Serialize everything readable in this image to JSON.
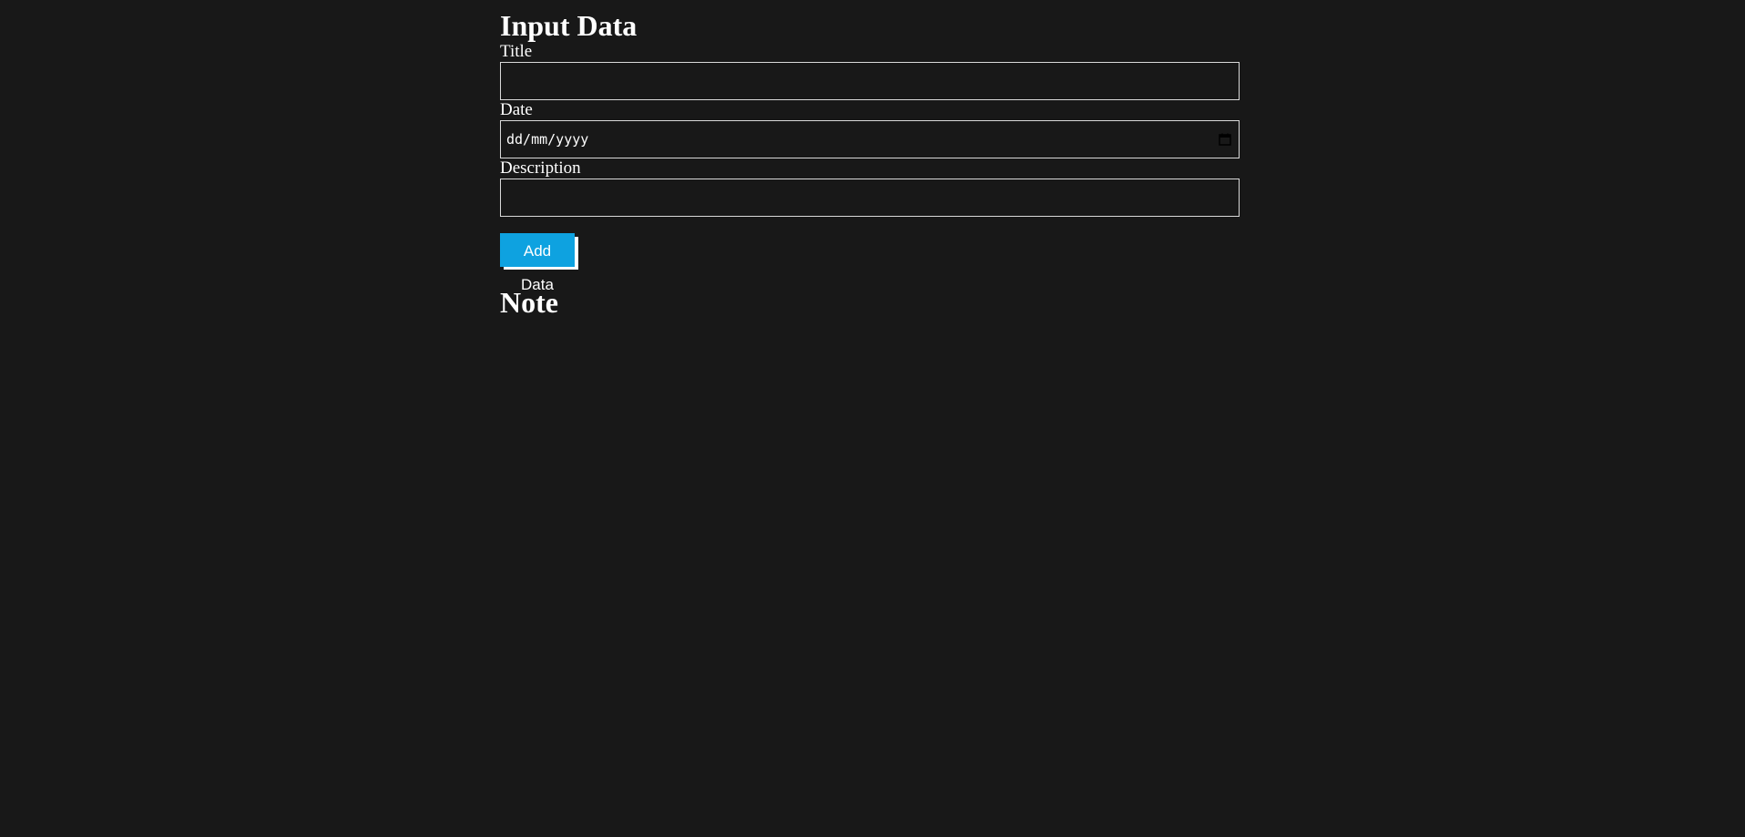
{
  "form": {
    "heading": "Input Data",
    "title_label": "Title",
    "title_value": "",
    "date_label": "Date",
    "date_placeholder": "dd/mm/yyyy",
    "description_label": "Description",
    "description_value": "",
    "submit_label": "Add Data"
  },
  "notes": {
    "heading": "Note"
  },
  "colors": {
    "background": "#181818",
    "accent": "#0ea2e0",
    "text": "#ffffff"
  },
  "icons": {
    "date_picker": "calendar-icon"
  }
}
